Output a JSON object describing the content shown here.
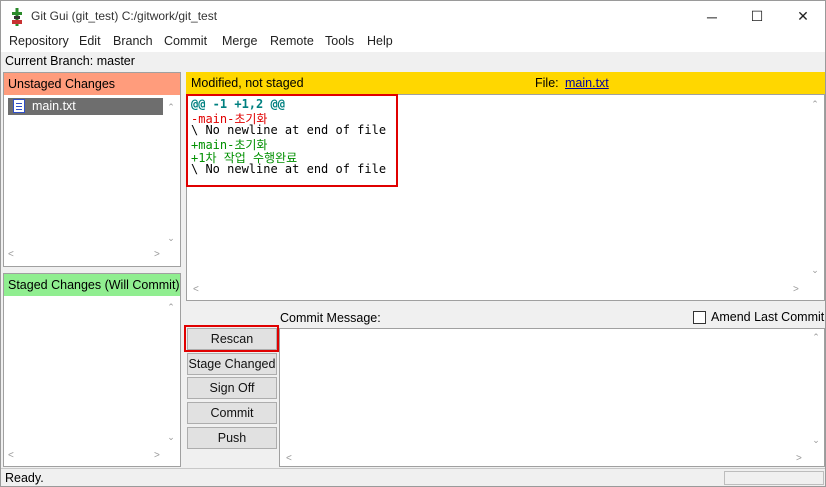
{
  "window": {
    "title": "Git Gui (git_test) C:/gitwork/git_test",
    "minimize": "─",
    "maximize": "☐",
    "close": "✕"
  },
  "menu": [
    "Repository",
    "Edit",
    "Branch",
    "Commit",
    "Merge",
    "Remote",
    "Tools",
    "Help"
  ],
  "current_branch": "Current Branch: master",
  "unstaged": {
    "title": "Unstaged Changes",
    "files": [
      {
        "name": "main.txt",
        "icon": "modified-file-icon"
      }
    ]
  },
  "staged": {
    "title": "Staged Changes (Will Commit)",
    "files": []
  },
  "diff": {
    "status": "Modified, not staged",
    "file_label": "File:",
    "file_name": "main.txt",
    "lines": [
      {
        "type": "hunk",
        "text": "@@ -1 +1,2 @@"
      },
      {
        "type": "del",
        "text": "-main-초기화"
      },
      {
        "type": "ctx",
        "text": "\\ No newline at end of file"
      },
      {
        "type": "add",
        "text": "+main-초기화"
      },
      {
        "type": "add",
        "text": "+1차 작업 수행완료"
      },
      {
        "type": "ctx",
        "text": "\\ No newline at end of file"
      }
    ]
  },
  "buttons": {
    "rescan": "Rescan",
    "stage_changed": "Stage Changed",
    "sign_off": "Sign Off",
    "commit": "Commit",
    "push": "Push"
  },
  "commit": {
    "label": "Commit Message:",
    "amend_label": "Amend Last Commit",
    "amend_checked": false,
    "message": ""
  },
  "status": "Ready.",
  "colors": {
    "unstaged_header": "#ff9c7c",
    "staged_header": "#90ee90",
    "diff_header": "#ffd700",
    "highlight": "#e00000"
  }
}
